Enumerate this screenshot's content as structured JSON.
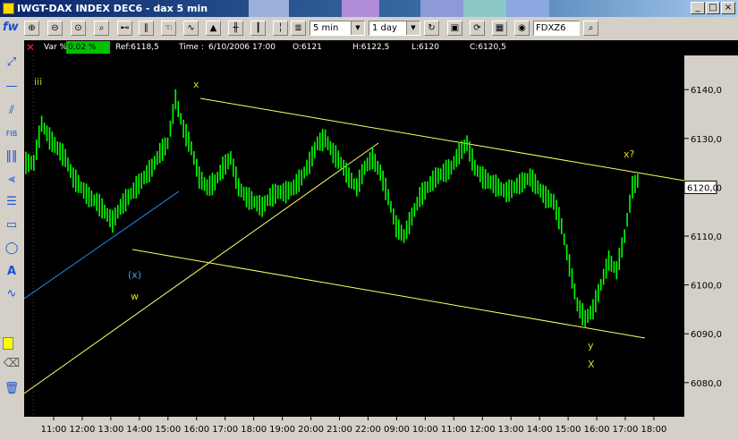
{
  "window": {
    "title": "IWGT-DAX INDEX DEC6 - dax 5 min",
    "min_label": "_",
    "max_label": "□",
    "close_label": "×"
  },
  "toolbar": {
    "fw_label": "fw",
    "timeframe": "5 min",
    "range": "1 day",
    "symbol": "FDXZ6",
    "colors": [
      "#c6d2e6",
      "#9ab0d8",
      "#b08cd8",
      "#8c9ad8",
      "#8cc8c8",
      "#8ca8e0"
    ]
  },
  "info": {
    "var_label": "Var %:",
    "var_value": "0,02 %",
    "ref": "Ref:6118,5",
    "time_label": "Time :",
    "time_value": "6/10/2006 17:00",
    "open": "O:6121",
    "high": "H:6122,5",
    "low": "L:6120",
    "close": "C:6120,5"
  },
  "annotations": {
    "iii": "iii",
    "x_top": "x",
    "x_paren": "(x)",
    "w": "w",
    "y": "y",
    "X": "X",
    "x_q": "x?"
  },
  "chart_data": {
    "type": "line",
    "title": "",
    "series": [
      {
        "values": [
          6125,
          6133,
          6130,
          6128,
          6126,
          6122,
          6120,
          6118,
          6117,
          6115,
          6113,
          6116,
          6118,
          6120,
          6122,
          6124,
          6127,
          6129,
          6138,
          6132,
          6128,
          6122,
          6120,
          6121,
          6124,
          6126,
          6120,
          6118,
          6117,
          6116,
          6118,
          6119,
          6119,
          6120,
          6122,
          6125,
          6129,
          6130,
          6127,
          6125,
          6122,
          6120,
          6124,
          6126,
          6123,
          6118,
          6112,
          6110,
          6114,
          6118,
          6120,
          6122,
          6123,
          6124,
          6127,
          6129,
          6124,
          6122,
          6121,
          6120,
          6119,
          6120,
          6121,
          6122,
          6120,
          6118,
          6117,
          6112,
          6104,
          6096,
          6093,
          6095,
          6100,
          6105,
          6103,
          6110,
          6120,
          6122
        ]
      }
    ],
    "x_ticks": [
      "11:00",
      "12:00",
      "13:00",
      "14:00",
      "15:00",
      "16:00",
      "17:00",
      "18:00",
      "19:00",
      "20:00",
      "21:00",
      "22:00",
      "09:00",
      "10:00",
      "11:00",
      "12:00",
      "13:00",
      "14:00",
      "15:00",
      "16:00",
      "17:00",
      "18:00"
    ],
    "y_ticks": [
      "6140,0",
      "6130,0",
      "6120,0",
      "6110,0",
      "6100,0",
      "6090,0",
      "6080,0"
    ],
    "ylim": [
      6073,
      6147
    ],
    "last_value": "6120,0",
    "series_color": "#00ff00",
    "channel_color": "#ffff66",
    "trendline_color": "#1e90ff"
  }
}
